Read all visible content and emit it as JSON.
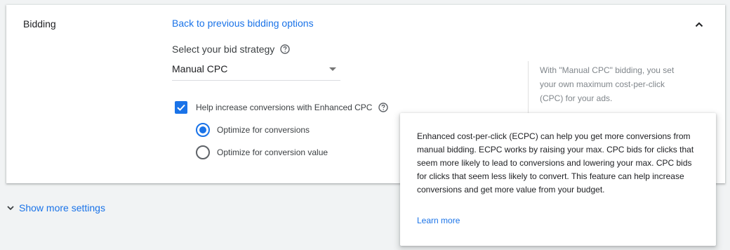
{
  "section": {
    "title": "Bidding",
    "back_link": "Back to previous bidding options",
    "strategy_label": "Select your bid strategy",
    "selected_strategy": "Manual CPC",
    "side_note": "With \"Manual CPC\" bidding, you set your own maximum cost-per-click (CPC) for your ads.",
    "enhanced_cpc": {
      "label": "Help increase conversions with Enhanced CPC",
      "checked": true
    },
    "options": [
      {
        "label": "Optimize for conversions",
        "selected": true
      },
      {
        "label": "Optimize for conversion value",
        "selected": false
      }
    ]
  },
  "footer": {
    "show_more_label": "Show more settings"
  },
  "tooltip": {
    "text": "Enhanced cost-per-click (ECPC) can help you get more conversions from manual bidding. ECPC works by raising your max. CPC bids for clicks that seem more likely to lead to conversions and lowering your max. CPC bids for clicks that seem less likely to convert. This feature can help increase conversions and get more value from your budget.",
    "learn_more": "Learn more"
  },
  "colors": {
    "accent": "#1a73e8",
    "background": "#f1f3f4",
    "card": "#ffffff",
    "muted_text": "#80868b"
  },
  "icons": {
    "collapse": "chevron-up-icon",
    "help": "help-circle-icon",
    "dropdown": "dropdown-arrow-icon",
    "check": "check-icon",
    "expand": "chevron-down-icon"
  }
}
